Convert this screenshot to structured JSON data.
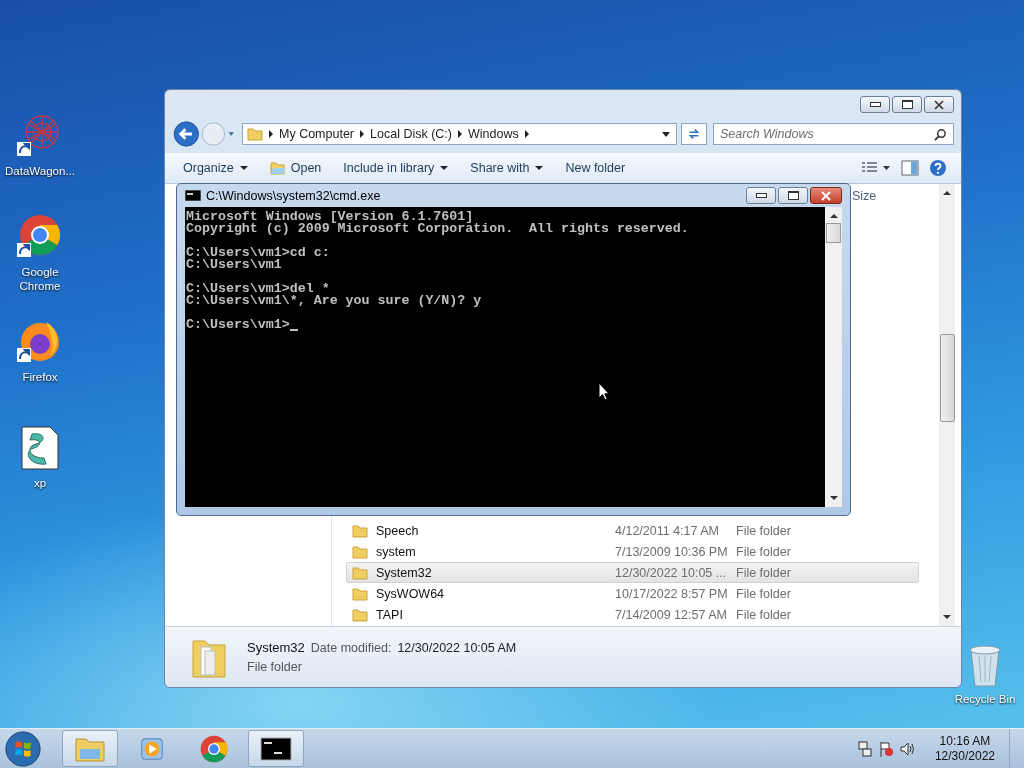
{
  "desktop_icons": [
    {
      "label": "DataWagon...",
      "kind": "datawagon",
      "shortcut": true
    },
    {
      "label": "Google Chrome",
      "kind": "chrome",
      "shortcut": true
    },
    {
      "label": "Firefox",
      "kind": "firefox",
      "shortcut": true
    },
    {
      "label": "xp",
      "kind": "script",
      "shortcut": false
    },
    {
      "label": "Recycle Bin",
      "kind": "recycle",
      "shortcut": false
    }
  ],
  "explorer": {
    "breadcrumb": [
      "My Computer",
      "Local Disk (C:)",
      "Windows"
    ],
    "search": {
      "placeholder": "Search Windows"
    },
    "toolbar": [
      {
        "label": "Organize",
        "kind": "menu"
      },
      {
        "label": "Open",
        "kind": "open"
      },
      {
        "label": "Include in library",
        "kind": "menu"
      },
      {
        "label": "Share with",
        "kind": "menu"
      },
      {
        "label": "New folder",
        "kind": "plain"
      }
    ],
    "column_header": "Size",
    "files": [
      {
        "name": "Speech",
        "date": "4/12/2011 4:17 AM",
        "type": "File folder",
        "selected": false
      },
      {
        "name": "system",
        "date": "7/13/2009 10:36 PM",
        "type": "File folder",
        "selected": false
      },
      {
        "name": "System32",
        "date": "12/30/2022 10:05 ...",
        "type": "File folder",
        "selected": true
      },
      {
        "name": "SysWOW64",
        "date": "10/17/2022 8:57 PM",
        "type": "File folder",
        "selected": false
      },
      {
        "name": "TAPI",
        "date": "7/14/2009 12:57 AM",
        "type": "File folder",
        "selected": false
      }
    ],
    "details": {
      "name": "System32",
      "label": "Date modified:",
      "value": "12/30/2022 10:05 AM",
      "type": "File folder"
    }
  },
  "cmd": {
    "title": "C:\\Windows\\system32\\cmd.exe",
    "blocks": [
      [
        "Microsoft Windows [Version 6.1.7601]",
        "Copyright (c) 2009 Microsoft Corporation.  All rights reserved."
      ],
      [
        "C:\\Users\\vm1>cd c:",
        "C:\\Users\\vm1"
      ],
      [
        "C:\\Users\\vm1>del *",
        "C:\\Users\\vm1\\*, Are you sure (Y/N)? y"
      ],
      [
        "C:\\Users\\vm1>"
      ]
    ],
    "cursor": true
  },
  "taskbar": {
    "items": [
      {
        "kind": "explorer",
        "active": true
      },
      {
        "kind": "media",
        "active": false
      },
      {
        "kind": "chrome",
        "active": false
      },
      {
        "kind": "cmd",
        "active": true
      }
    ],
    "time": "10:16 AM",
    "date": "12/30/2022"
  }
}
